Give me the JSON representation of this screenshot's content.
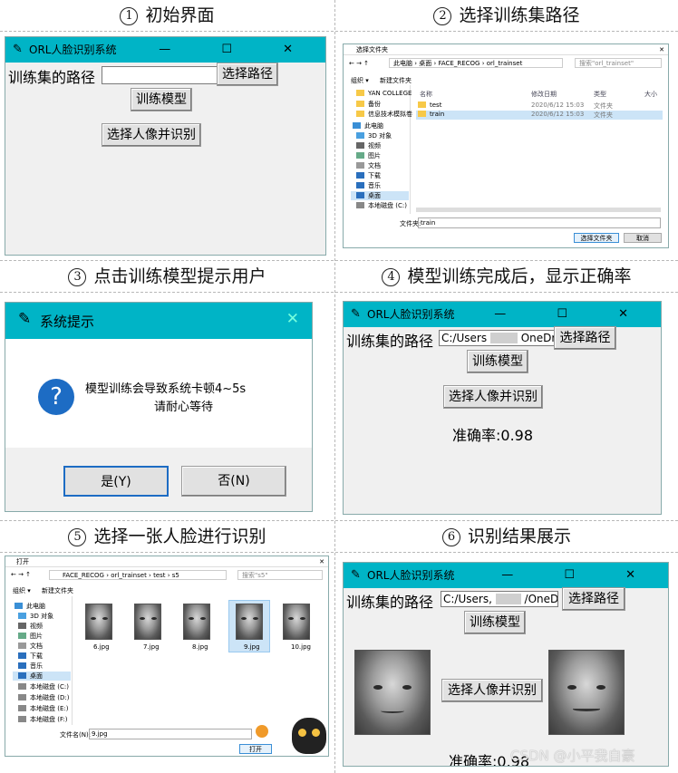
{
  "captions": {
    "c1": {
      "num": "1",
      "text": "初始界面"
    },
    "c2": {
      "num": "2",
      "text": "选择训练集路径"
    },
    "c3": {
      "num": "3",
      "text": "点击训练模型提示用户"
    },
    "c4": {
      "num": "4",
      "text": "模型训练完成后，显示正确率"
    },
    "c5": {
      "num": "5",
      "text": "选择一张人脸进行识别"
    },
    "c6": {
      "num": "6",
      "text": "识别结果展示"
    }
  },
  "app": {
    "title": "ORL人脸识别系统",
    "path_label": "训练集的路径",
    "choose_path": "选择路径",
    "train": "训练模型",
    "recognize": "选择人像并识别",
    "path_value_a": "C:/Users",
    "path_value_b": "OneDriv",
    "path_value_c": "C:/Users,",
    "path_value_d": "/OneDriv",
    "accuracy": "准确率:0.98",
    "win_controls": "— ☐ ✕"
  },
  "folder_dialog": {
    "title": "选择文件夹",
    "breadcrumb": [
      "此电脑",
      "桌面",
      "FACE_RECOG",
      "orl_trainset"
    ],
    "search": "搜索\"orl_trainset\"",
    "organize": "组织 ▾",
    "new_folder": "新建文件夹",
    "columns": [
      "名称",
      "修改日期",
      "类型",
      "大小"
    ],
    "tree": [
      "YAN COLLEGE",
      "备份",
      "信息技术模拟卷",
      "此电脑",
      "3D 对象",
      "视频",
      "图片",
      "文档",
      "下载",
      "音乐",
      "桌面",
      "本地磁盘 (C:)"
    ],
    "rows": [
      {
        "name": "test",
        "date": "2020/6/12 15:03",
        "type": "文件夹"
      },
      {
        "name": "train",
        "date": "2020/6/12 15:03",
        "type": "文件夹"
      }
    ],
    "folder_label": "文件夹:",
    "folder_value": "train",
    "select_btn": "选择文件夹",
    "cancel_btn": "取消"
  },
  "msgbox": {
    "title": "系统提示",
    "line1": "模型训练会导致系统卡顿4~5s",
    "line2": "请耐心等待",
    "yes": "是(Y)",
    "no": "否(N)",
    "icon": "?"
  },
  "open_dialog": {
    "title": "打开",
    "breadcrumb": [
      "FACE_RECOG",
      "orl_trainset",
      "test",
      "s5"
    ],
    "search": "搜索\"s5\"",
    "organize": "组织 ▾",
    "new_folder": "新建文件夹",
    "tree": [
      "此电脑",
      "3D 对象",
      "视频",
      "图片",
      "文档",
      "下载",
      "音乐",
      "桌面",
      "本地磁盘 (C:)",
      "本地磁盘 (D:)",
      "本地磁盘 (E:)",
      "本地磁盘 (F:)"
    ],
    "files": [
      "6.jpg",
      "7.jpg",
      "8.jpg",
      "9.jpg",
      "10.jpg"
    ],
    "selected": "9.jpg",
    "filename_label": "文件名(N):",
    "filename_value": "9.jpg",
    "open_btn": "打开"
  },
  "watermark": "CSDN @小平我自豪"
}
